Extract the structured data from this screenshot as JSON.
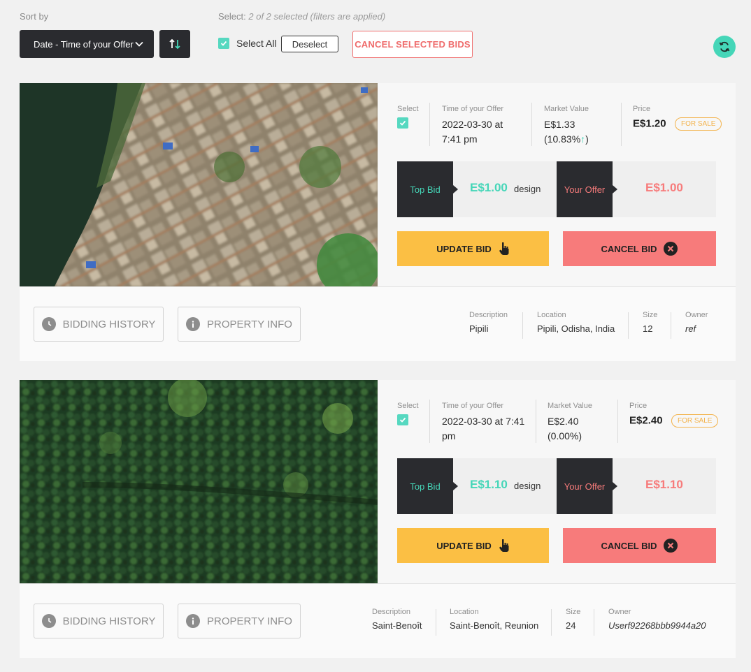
{
  "toolbar": {
    "sort_label": "Sort by",
    "sort_value": "Date - Time of your Offer",
    "select_prefix": "Select:",
    "select_status": "2 of 2 selected (filters are applied)",
    "select_all_label": "Select All",
    "deselect_label": "Deselect",
    "cancel_selected_label": "CANCEL SELECTED BIDS"
  },
  "colors": {
    "accent_teal": "#45d6b8",
    "update_yellow": "#fbbf44",
    "cancel_red": "#f77b7b",
    "dark": "#2a2b2f"
  },
  "labels": {
    "select": "Select",
    "time_of_offer": "Time of your Offer",
    "market_value": "Market Value",
    "price": "Price",
    "for_sale": "FOR SALE",
    "top_bid": "Top Bid",
    "your_offer": "Your Offer",
    "design": "design",
    "update_bid": "UPDATE BID",
    "cancel_bid": "CANCEL BID",
    "bidding_history": "BIDDING HISTORY",
    "property_info": "PROPERTY INFO",
    "description": "Description",
    "location": "Location",
    "size": "Size",
    "owner": "Owner"
  },
  "cards": [
    {
      "time_line1": "2022-03-30 at",
      "time_line2": "7:41 pm",
      "market_value": "E$1.33",
      "market_change": "(10.83%",
      "market_change_end": ")",
      "price": "E$1.20",
      "top_bid": "E$1.00",
      "your_offer": "E$1.00",
      "description": "Pipili",
      "location": "Pipili, Odisha, India",
      "size": "12",
      "owner": "ref",
      "image_icon": "urban-satellite-image"
    },
    {
      "time_line1": "2022-03-30 at 7:41",
      "time_line2": "pm",
      "market_value": "E$2.40",
      "market_change": "(0.00%)",
      "price": "E$2.40",
      "top_bid": "E$1.10",
      "your_offer": "E$1.10",
      "description": "Saint-Benoît",
      "location": "Saint-Benoît, Reunion",
      "size": "24",
      "owner": "Userf92268bbb9944a20",
      "image_icon": "forest-satellite-image"
    }
  ]
}
